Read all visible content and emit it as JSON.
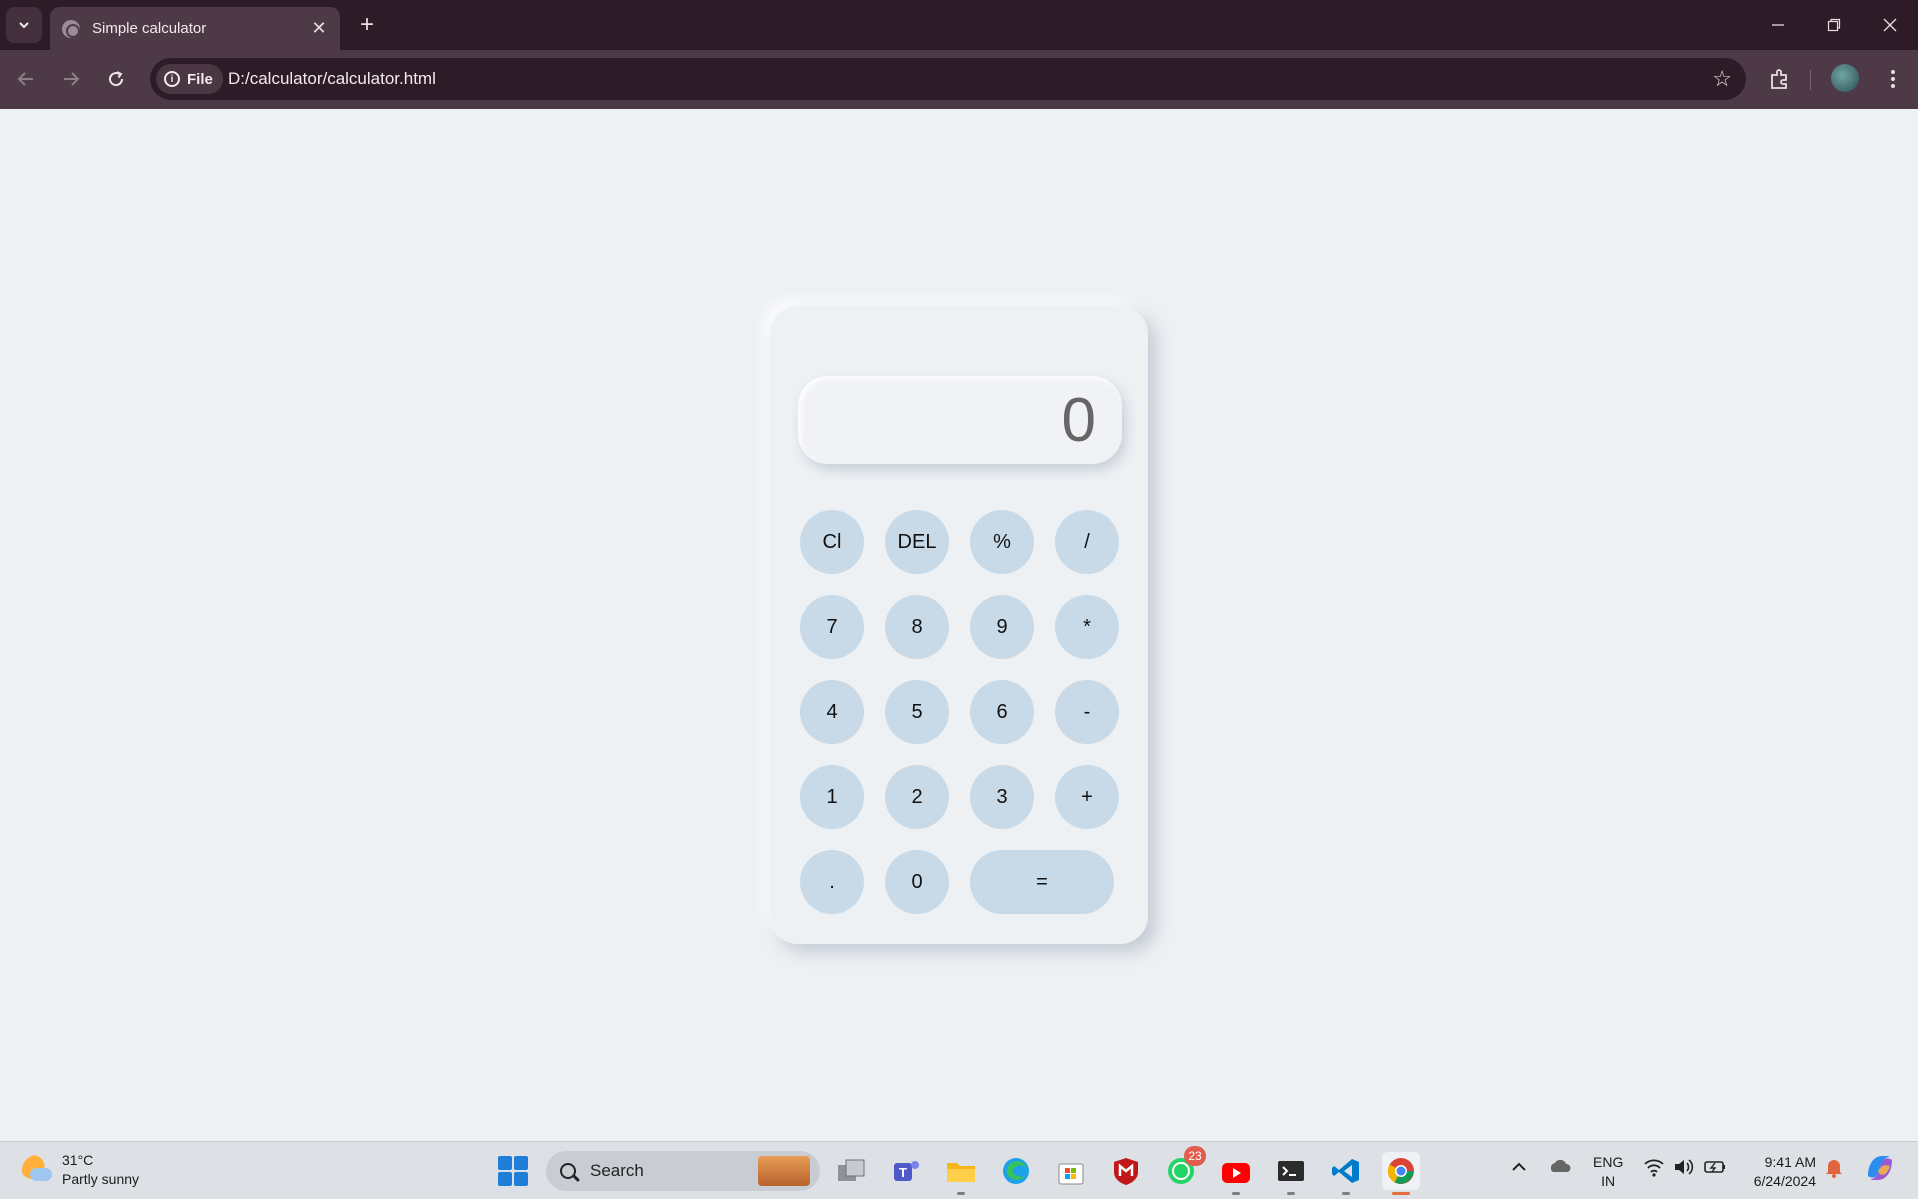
{
  "browser": {
    "tab_title": "Simple calculator",
    "close_symbol": "✕",
    "new_tab_symbol": "+",
    "chip_label": "File",
    "url": "D:/calculator/calculator.html",
    "minimize_symbol": "—",
    "restore_symbol": "❐",
    "window_close_symbol": "✕"
  },
  "calculator": {
    "display_value": "0",
    "rows": [
      [
        "Cl",
        "DEL",
        "%",
        "/"
      ],
      [
        "7",
        "8",
        "9",
        "*"
      ],
      [
        "4",
        "5",
        "6",
        "-"
      ],
      [
        "1",
        "2",
        "3",
        "+"
      ],
      [
        ".",
        "0",
        "="
      ]
    ],
    "key_color": "#c8d9e7",
    "body_color": "#eef1f4"
  },
  "taskbar": {
    "weather_temp": "31°C",
    "weather_desc": "Partly sunny",
    "search_label": "Search",
    "whatsapp_badge": "23",
    "lang_line1": "ENG",
    "lang_line2": "IN",
    "time": "9:41 AM",
    "date": "6/24/2024",
    "apps": [
      "task-view",
      "teams",
      "file-explorer",
      "edge",
      "store",
      "mcafee",
      "whatsapp",
      "youtube",
      "terminal",
      "vscode",
      "chrome"
    ]
  }
}
